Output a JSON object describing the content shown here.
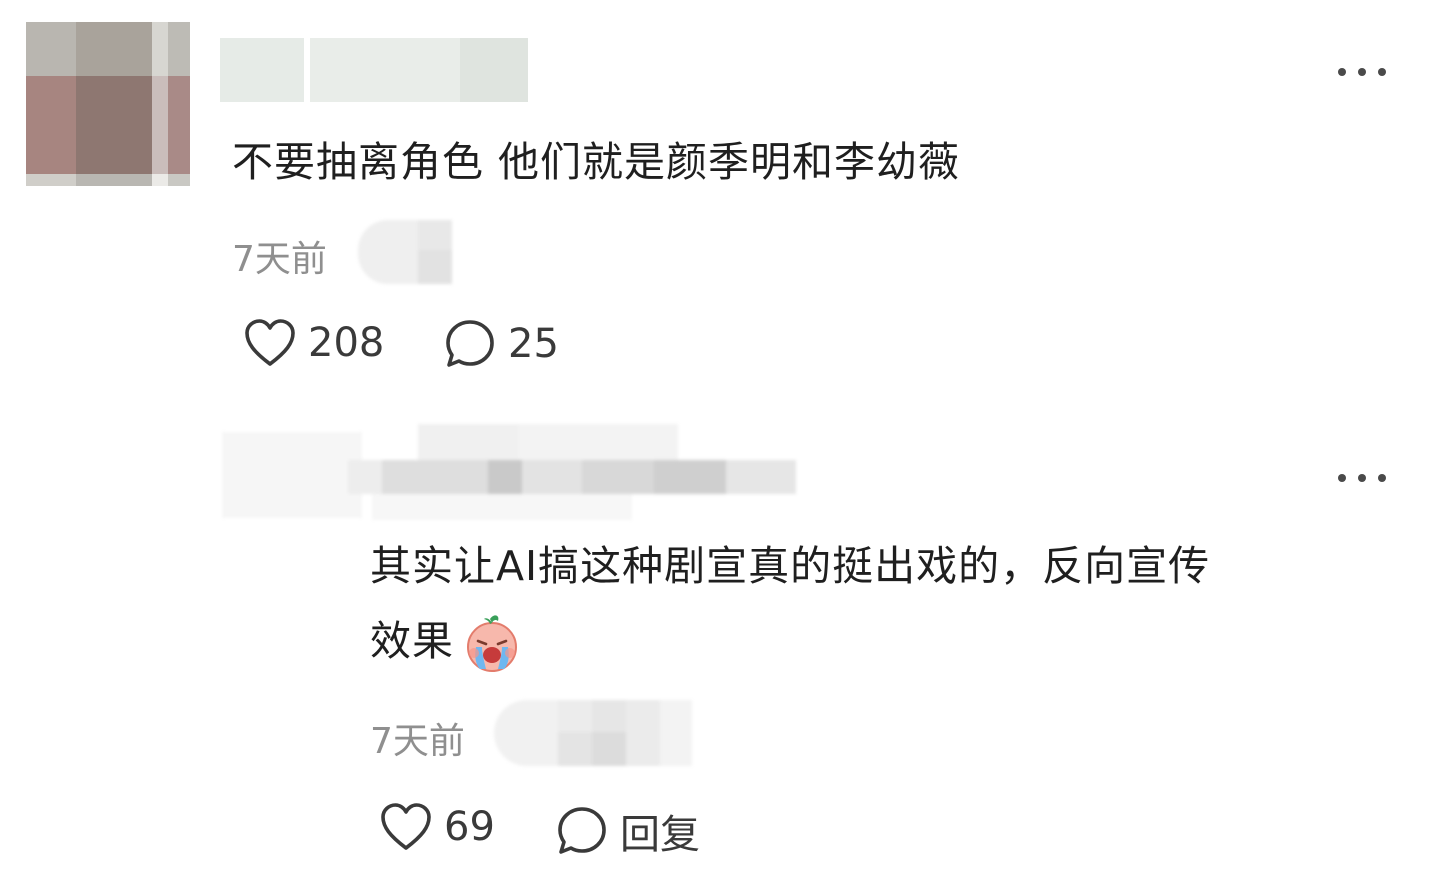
{
  "comment": {
    "text": "不要抽离角色 他们就是颜季明和李幼薇",
    "time": "7天前",
    "likes": "208",
    "replies_count": "25",
    "author_censored": true
  },
  "reply": {
    "text_line1": "其实让AI搞这种剧宣真的挺出戏的，反向宣传",
    "text_line2": "效果",
    "emoji": "crying-face-emoji",
    "time": "7天前",
    "likes": "69",
    "reply_label": "回复",
    "author_censored": true
  },
  "colors": {
    "text": "#1f1f1f",
    "meta": "#8f8f8f",
    "icon": "#3a3a3a"
  }
}
